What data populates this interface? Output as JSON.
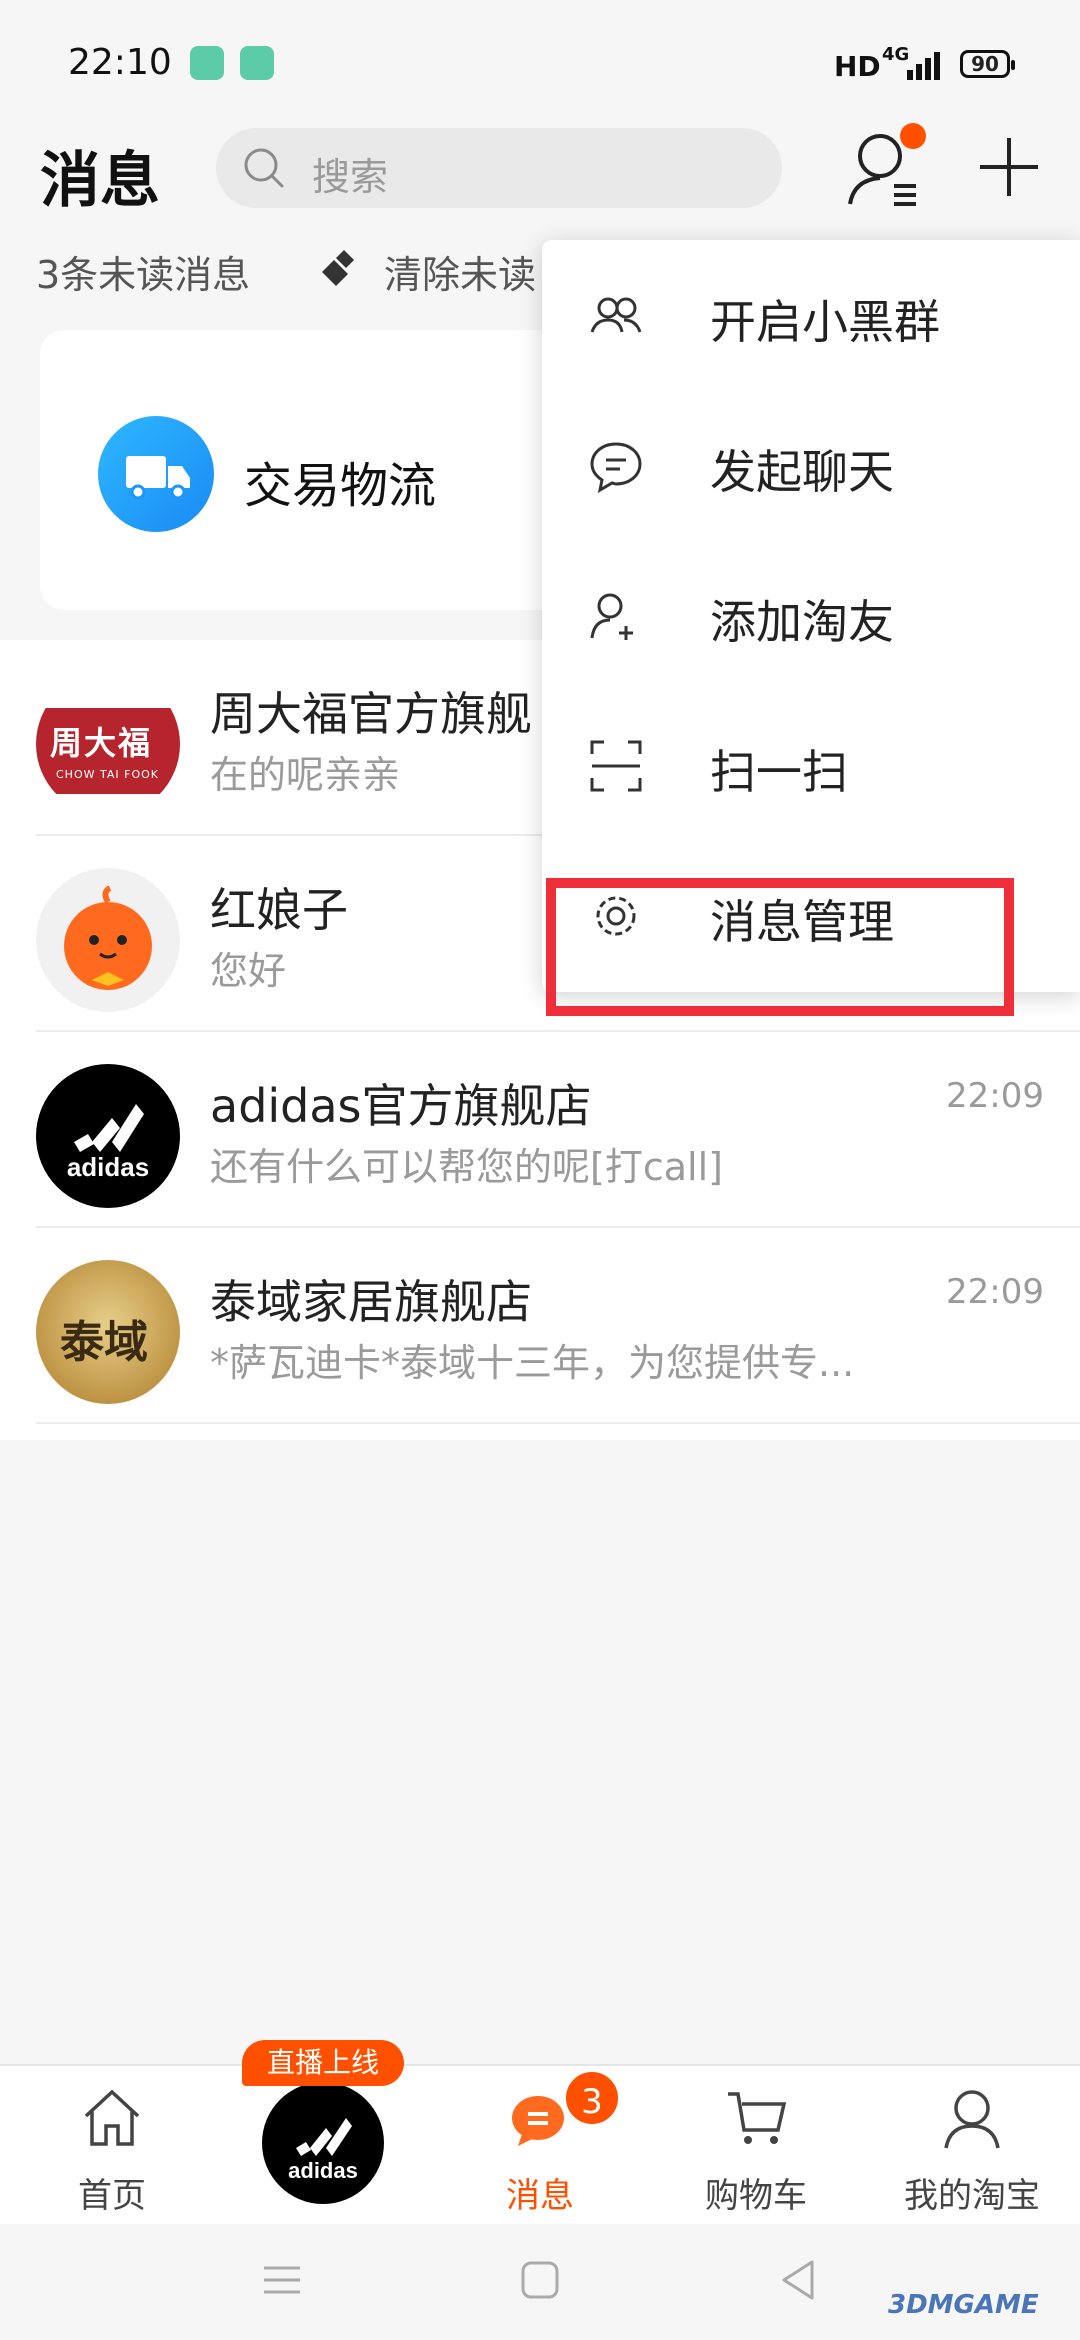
{
  "status_bar": {
    "time": "22:10",
    "hd": "HD",
    "network": "4G",
    "battery": "90"
  },
  "header": {
    "title": "消息",
    "search_placeholder": "搜索",
    "unread_text": "3条未读消息",
    "clear_text": "清除未读"
  },
  "logistics_card": {
    "label": "交易物流"
  },
  "conversations": [
    {
      "name": "周大福官方旗舰",
      "preview": "在的呢亲亲",
      "time": "",
      "avatar_text": "周大福",
      "avatar_subtext": "CHOW TAI FOOK"
    },
    {
      "name": "红娘子",
      "preview": "您好",
      "time": ""
    },
    {
      "name": "adidas官方旗舰店",
      "preview": "还有什么可以帮您的呢[打call]",
      "time": "22:09",
      "avatar_text": "adidas"
    },
    {
      "name": "泰域家居旗舰店",
      "preview": "*萨瓦迪卡*泰域十三年，为您提供专...",
      "time": "22:09",
      "avatar_text": "泰域"
    }
  ],
  "menu": {
    "items": [
      {
        "label": "开启小黑群",
        "icon": "group-icon"
      },
      {
        "label": "发起聊天",
        "icon": "chat-bubble-icon"
      },
      {
        "label": "添加淘友",
        "icon": "add-friend-icon"
      },
      {
        "label": "扫一扫",
        "icon": "scan-icon"
      },
      {
        "label": "消息管理",
        "icon": "gear-icon"
      }
    ],
    "highlight_color": "#ee2f3a"
  },
  "tabbar": {
    "tabs": [
      {
        "label": "首页",
        "icon": "home-icon"
      },
      {
        "label": "",
        "icon": "adidas-logo"
      },
      {
        "label": "消息",
        "icon": "message-icon",
        "badge": "3",
        "active": true
      },
      {
        "label": "购物车",
        "icon": "cart-icon"
      },
      {
        "label": "我的淘宝",
        "icon": "profile-icon"
      }
    ],
    "live_badge": "直播上线",
    "accent_color": "#ff5000"
  },
  "watermark": "3DMGAME"
}
